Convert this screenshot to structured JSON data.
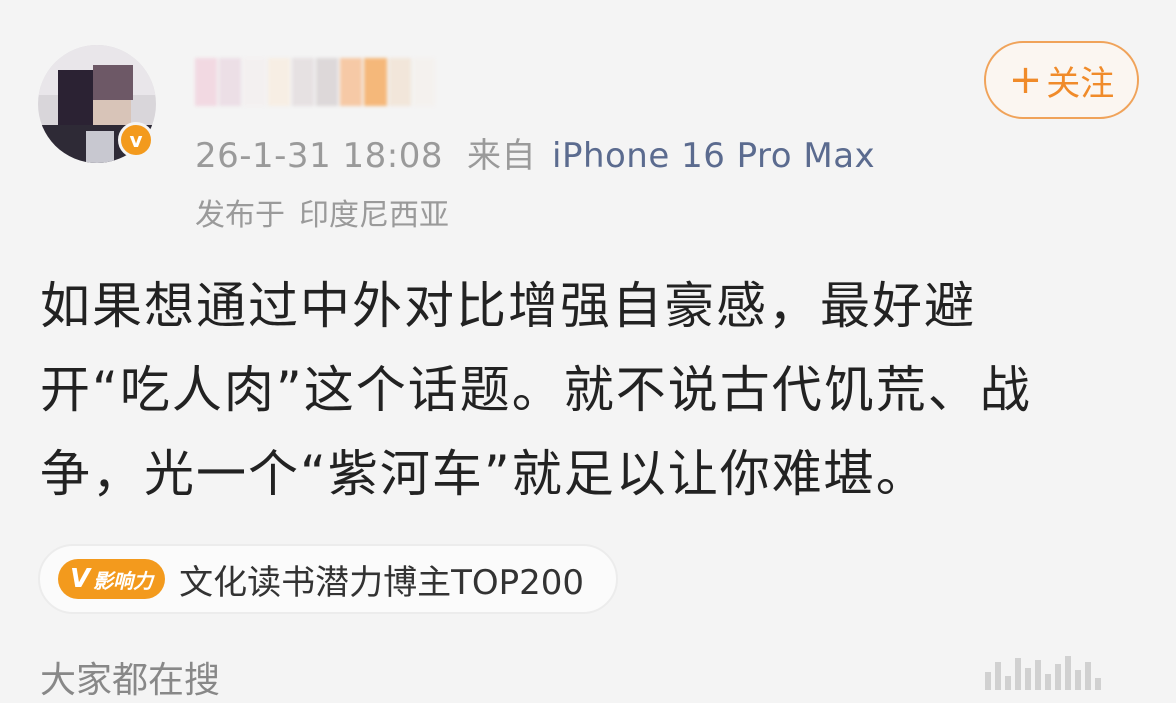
{
  "post": {
    "timestamp": "26-1-31 18:08",
    "source_prefix": "来自",
    "device": "iPhone 16 Pro Max",
    "location_prefix": "发布于",
    "location": "印度尼西亚",
    "follow_label": "关注",
    "content_lines": [
      "如果想通过中外对比增强自豪感，最好避",
      "开“吃人肉”这个话题。就不说古代饥荒、战",
      "争，光一个“紫河车”就足以让你难堪。"
    ]
  },
  "badge": {
    "icon_text": "影响力",
    "icon_letter": "V",
    "label": "文化读书潜力博主TOP200"
  },
  "footer": {
    "search_label": "大家都在搜"
  },
  "colors": {
    "accent": "#f39a1d",
    "follow_border": "#f0a35a",
    "device_link": "#5b6b8f",
    "meta_gray": "#9a9a9a",
    "body_text": "#222222"
  },
  "icons": {
    "verified": "verified-badge-icon",
    "plus": "plus-icon"
  }
}
